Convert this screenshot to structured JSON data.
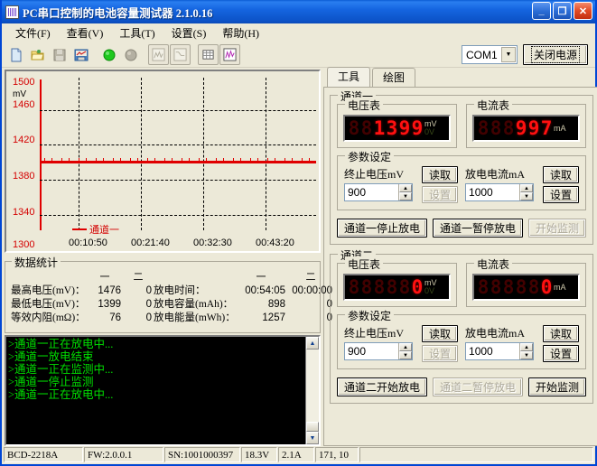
{
  "window": {
    "title": "PC串口控制的电池容量测试器  2.1.0.16",
    "minimize": "_",
    "maximize": "❐",
    "close": "✕"
  },
  "menu": [
    {
      "label": "文件(F)"
    },
    {
      "label": "查看(V)"
    },
    {
      "label": "工具(T)"
    },
    {
      "label": "设置(S)"
    },
    {
      "label": "帮助(H)"
    }
  ],
  "toolbar": {
    "com_port": "COM1",
    "com_arrow": "▼",
    "power_button": "关闭电源"
  },
  "chart_data": {
    "type": "line",
    "title": "",
    "xlabel": "",
    "ylabel": "mV",
    "ylim": [
      1300,
      1500
    ],
    "yticks": [
      1500,
      1460,
      1420,
      1380,
      1340,
      1300
    ],
    "xticks": [
      "00:10:50",
      "00:21:40",
      "00:32:30",
      "00:43:20"
    ],
    "grid": true,
    "legend_position": "bottom-left",
    "series": [
      {
        "name": "通道一",
        "color": "#e00000",
        "approx_value": 1400,
        "values": [
          1400,
          1400,
          1399,
          1400,
          1399,
          1400,
          1399,
          1400,
          1399,
          1400
        ]
      }
    ]
  },
  "stats": {
    "legend": "数据统计",
    "col_head_1": "一",
    "col_head_2": "二",
    "rows": [
      {
        "label": "最高电压(mV)：",
        "ch1": "1476",
        "ch2": "0",
        "label2": "放电时间：",
        "ch1b": "00:54:05",
        "ch2b": "00:00:00"
      },
      {
        "label": "最低电压(mV)：",
        "ch1": "1399",
        "ch2": "0",
        "label2": "放电容量(mAh)：",
        "ch1b": "898",
        "ch2b": "0"
      },
      {
        "label": "等效内阻(mΩ)：",
        "ch1": "76",
        "ch2": "0",
        "label2": "放电能量(mWh)：",
        "ch1b": "1257",
        "ch2b": "0"
      }
    ]
  },
  "log": {
    "lines": [
      ">通道一正在放电中...",
      ">通道一放电结束",
      ">通道一正在监测中...",
      ">通道一停止监测",
      ">通道一正在放电中..."
    ],
    "scroll_up": "▲",
    "scroll_down": "▼"
  },
  "tabs": [
    {
      "label": "工具",
      "active": true
    },
    {
      "label": "绘图",
      "active": false
    }
  ],
  "channel1": {
    "legend": "通道一",
    "voltmeter": {
      "legend": "电压表",
      "digits": [
        "8",
        "8",
        "1",
        "3",
        "9",
        "9"
      ],
      "lit": [
        false,
        false,
        true,
        true,
        true,
        true
      ],
      "unit_top": "mV",
      "unit_bottom": "0V",
      "value": "1399"
    },
    "ammeter": {
      "legend": "电流表",
      "digits": [
        "8",
        "8",
        "8",
        "9",
        "9",
        "7"
      ],
      "lit": [
        false,
        false,
        false,
        true,
        true,
        true
      ],
      "unit_top": "mA",
      "unit_bottom": "",
      "value": "997"
    },
    "params": {
      "legend": "参数设定",
      "cutoff_label": "终止电压mV",
      "cutoff_value": "900",
      "current_label": "放电电流mA",
      "current_value": "1000",
      "read_label": "读取",
      "set_label": "设置",
      "set_left_enabled": false,
      "set_right_enabled": true
    },
    "actions": [
      {
        "label": "通道一停止放电",
        "enabled": true
      },
      {
        "label": "通道一暂停放电",
        "enabled": true
      },
      {
        "label": "开始监测",
        "enabled": false
      }
    ]
  },
  "channel2": {
    "legend": "通道二",
    "voltmeter": {
      "legend": "电压表",
      "digits": [
        "8",
        "8",
        "8",
        "8",
        "8",
        "0"
      ],
      "lit": [
        false,
        false,
        false,
        false,
        false,
        true
      ],
      "unit_top": "mV",
      "unit_bottom": "0V",
      "value": "0"
    },
    "ammeter": {
      "legend": "电流表",
      "digits": [
        "8",
        "8",
        "8",
        "8",
        "8",
        "0"
      ],
      "lit": [
        false,
        false,
        false,
        false,
        false,
        true
      ],
      "unit_top": "mA",
      "unit_bottom": "",
      "value": "0"
    },
    "params": {
      "legend": "参数设定",
      "cutoff_label": "终止电压mV",
      "cutoff_value": "900",
      "current_label": "放电电流mA",
      "current_value": "1000",
      "read_label": "读取",
      "set_label": "设置",
      "set_left_enabled": false,
      "set_right_enabled": true
    },
    "actions": [
      {
        "label": "通道二开始放电",
        "enabled": true
      },
      {
        "label": "通道二暂停放电",
        "enabled": false
      },
      {
        "label": "开始监测",
        "enabled": true
      }
    ]
  },
  "statusbar": [
    {
      "text": "BCD-2218A"
    },
    {
      "text": "FW:2.0.0.1"
    },
    {
      "text": "SN:1001000397"
    },
    {
      "text": "18.3V"
    },
    {
      "text": "2.1A"
    },
    {
      "text": "171, 10"
    },
    {
      "text": ""
    }
  ],
  "colors": {
    "trace": "#e00000",
    "led_on": "#ff1010",
    "led_off": "#420000",
    "log_text": "#00e000",
    "title_bar": "#0c53c8"
  }
}
